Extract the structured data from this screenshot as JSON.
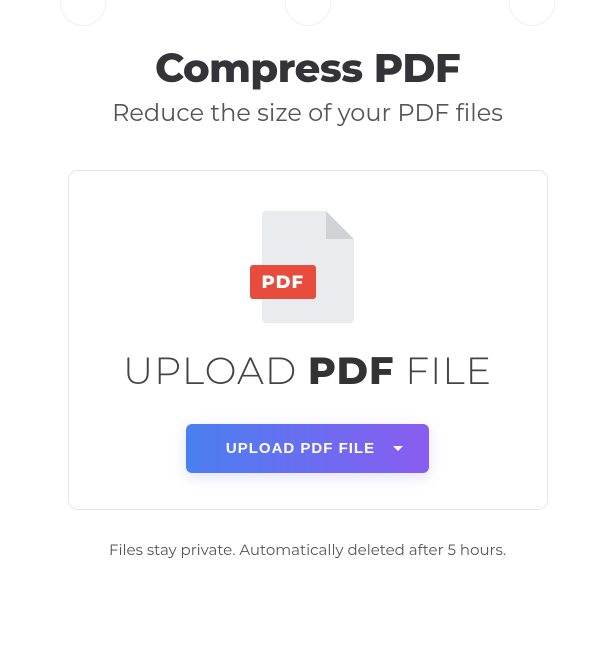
{
  "page": {
    "title": "Compress PDF",
    "subtitle": "Reduce the size of your PDF files"
  },
  "fileIcon": {
    "badge": "PDF"
  },
  "uploadText": {
    "seg1": "UPLOAD ",
    "segBold": "PDF",
    "seg2": " FILE"
  },
  "buttons": {
    "uploadLabel": "UPLOAD PDF FILE"
  },
  "footnote": "Files stay private. Automatically deleted after 5 hours."
}
